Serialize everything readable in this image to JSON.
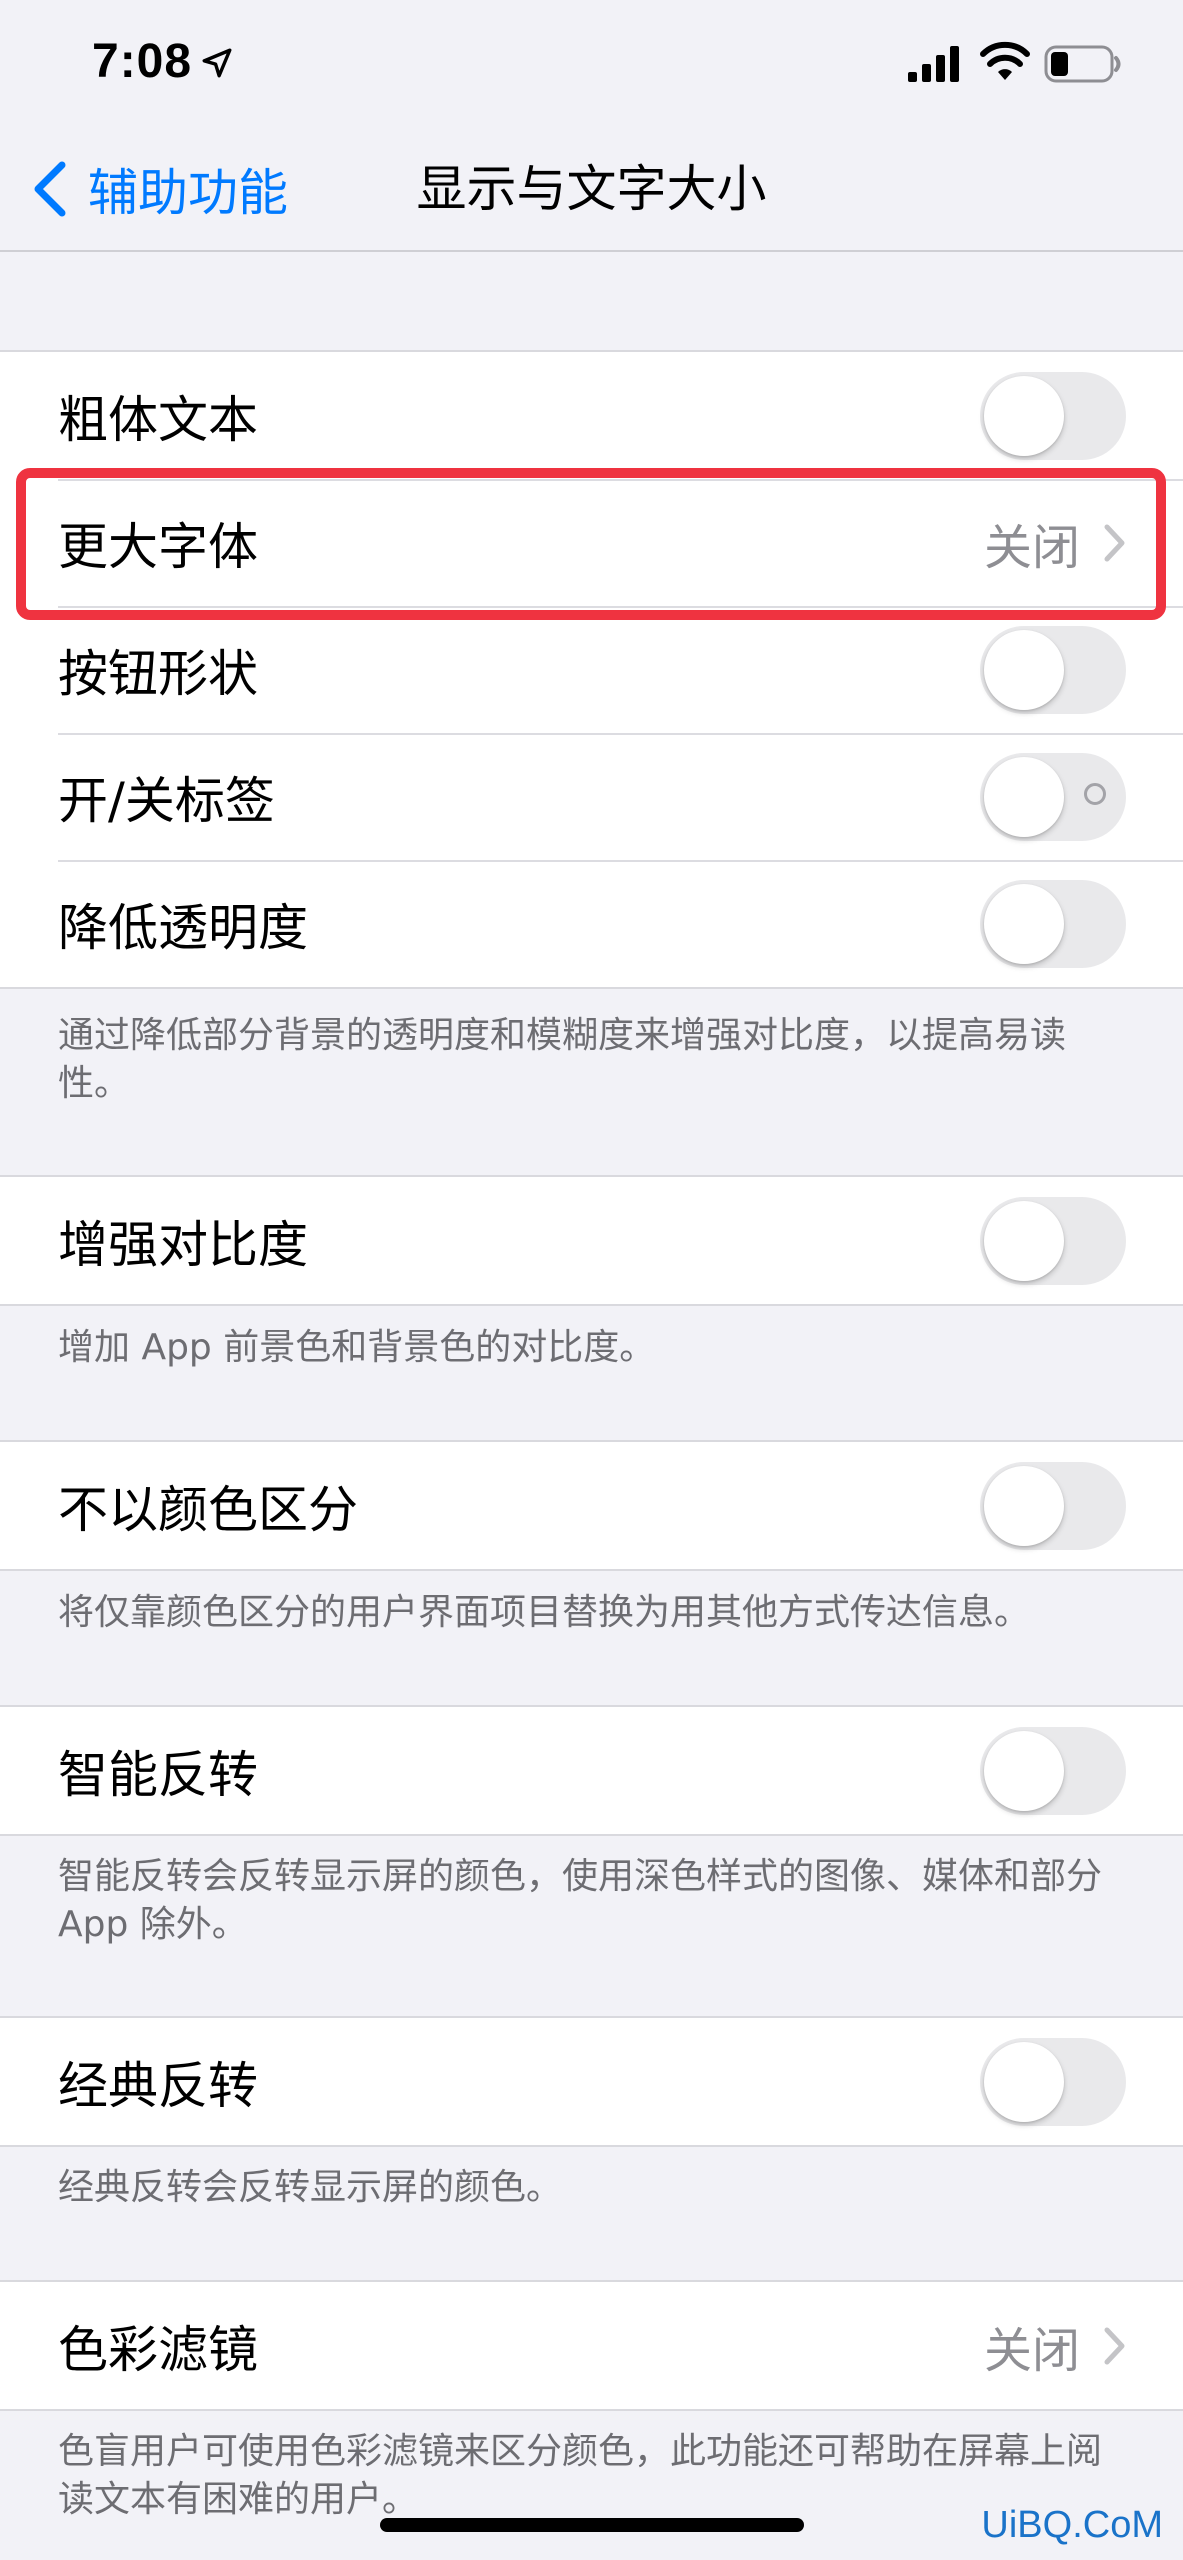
{
  "status_bar": {
    "time": "7:08",
    "location_icon": "location-arrow-icon",
    "signal_icon": "cellular-signal-icon",
    "wifi_icon": "wifi-icon",
    "battery_icon": "battery-icon",
    "battery_level": 0.3
  },
  "nav": {
    "back_label": "辅助功能",
    "title": "显示与文字大小",
    "accent_color": "#007aff"
  },
  "groups": {
    "main": {
      "rows": [
        {
          "label": "粗体文本",
          "type": "toggle",
          "on": false
        },
        {
          "label": "更大字体",
          "type": "value",
          "value": "关闭"
        },
        {
          "label": "按钮形状",
          "type": "toggle",
          "on": false
        },
        {
          "label": "开/关标签",
          "type": "toggle",
          "on": false
        },
        {
          "label": "降低透明度",
          "type": "toggle",
          "on": false
        }
      ],
      "footnote": "通过降低部分背景的透明度和模糊度来增强对比度，以提高易读性。"
    },
    "contrast": {
      "label": "增强对比度",
      "on": false,
      "footnote": "增加 App 前景色和背景色的对比度。"
    },
    "differentiate": {
      "label": "不以颜色区分",
      "on": false,
      "footnote": "将仅靠颜色区分的用户界面项目替换为用其他方式传达信息。"
    },
    "smart_invert": {
      "label": "智能反转",
      "on": false,
      "footnote": "智能反转会反转显示屏的颜色，使用深色样式的图像、媒体和部分 App 除外。"
    },
    "classic_invert": {
      "label": "经典反转",
      "on": false,
      "footnote": "经典反转会反转显示屏的颜色。"
    },
    "color_filters": {
      "label": "色彩滤镜",
      "value": "关闭",
      "footnote": "色盲用户可使用色彩滤镜来区分颜色，此功能还可帮助在屏幕上阅读文本有困难的用户。"
    }
  },
  "highlight_color": "#ef3340",
  "watermark": "UiBQ.CoM"
}
